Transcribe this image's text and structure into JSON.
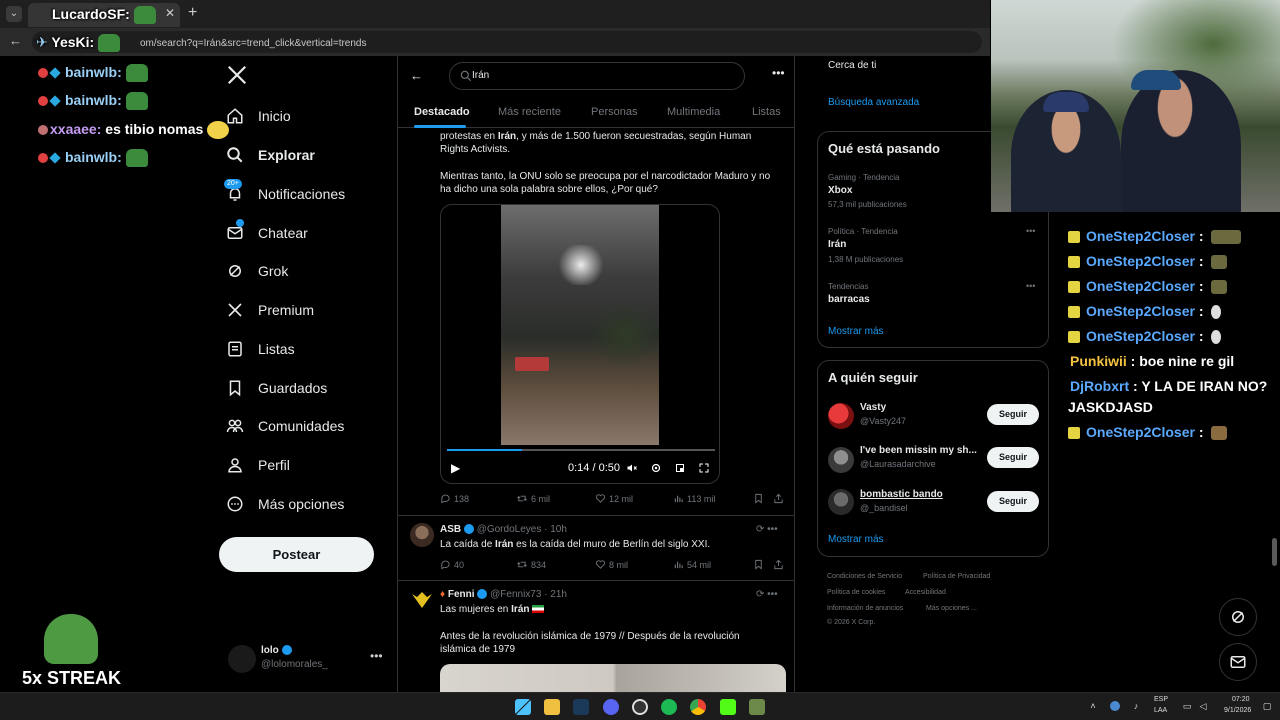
{
  "browser": {
    "tab_title": "LucardoSF:",
    "url": "om/search?q=Irán&src=trend_click&vertical=trends",
    "overlay_user": "YesKi:"
  },
  "overlay_chat": [
    {
      "user": "bainwlb:",
      "msg": ""
    },
    {
      "user": "bainwlb:",
      "msg": ""
    },
    {
      "user": "xxaaee:",
      "msg": "es tibio nomas"
    },
    {
      "user": "bainwlb:",
      "msg": ""
    }
  ],
  "nav": {
    "items": [
      {
        "label": "Inicio",
        "icon": "home-icon"
      },
      {
        "label": "Explorar",
        "icon": "search-icon"
      },
      {
        "label": "Notificaciones",
        "icon": "bell-icon",
        "badge": "20+"
      },
      {
        "label": "Chatear",
        "icon": "mail-icon"
      },
      {
        "label": "Grok",
        "icon": "grok-icon"
      },
      {
        "label": "Premium",
        "icon": "x-icon"
      },
      {
        "label": "Listas",
        "icon": "list-icon"
      },
      {
        "label": "Guardados",
        "icon": "bookmark-icon"
      },
      {
        "label": "Comunidades",
        "icon": "people-icon"
      },
      {
        "label": "Perfil",
        "icon": "user-icon"
      },
      {
        "label": "Más opciones",
        "icon": "more-icon"
      }
    ],
    "post_label": "Postear",
    "profile_name": "lolo",
    "profile_handle": "@lolomorales_"
  },
  "search": {
    "query": "Irán",
    "tabs": [
      "Destacado",
      "Más reciente",
      "Personas",
      "Multimedia",
      "Listas"
    ]
  },
  "tweet1": {
    "line1_pre": "protestas en ",
    "line1_bold": "Irán",
    "line1_post": ", y más de 1.500 fueron secuestradas, según Human",
    "line2": "Rights Activists.",
    "line3": "Mientras tanto, la ONU solo se preocupa por el narcodictador Maduro y no",
    "line4": "ha dicho una sola palabra sobre ellos, ¿Por qué?",
    "video_time": "0:14 / 0:50",
    "video_progress": 0.28,
    "replies": "138",
    "reposts": "6 mil",
    "likes": "12 mil",
    "views": "113 mil"
  },
  "tweet2": {
    "name": "ASB",
    "handle": "@GordoLeyes",
    "time": "· 10h",
    "text_pre": "La caída de ",
    "text_bold": "Irán",
    "text_post": " es la caída del muro de Berlín del siglo XXI.",
    "replies": "40",
    "reposts": "834",
    "likes": "8 mil",
    "views": "54 mil"
  },
  "tweet3": {
    "name": "Fenni",
    "handle": "@Fennix73",
    "time": "· 21h",
    "text1_pre": "Las mujeres en ",
    "text1_bold": "Irán",
    "text2": "Antes de la revolución islámica de 1979 // Después de la revolución",
    "text3": "islámica de 1979"
  },
  "right": {
    "search_filter": "Cerca de ti",
    "advanced": "Búsqueda avanzada",
    "trends_title": "Qué está pasando",
    "trends": [
      {
        "meta": "Gaming · Tendencia",
        "name": "Xbox",
        "count": "57,3 mil publicaciones"
      },
      {
        "meta": "Política · Tendencia",
        "name": "Irán",
        "count": "1,38 M publicaciones"
      },
      {
        "meta": "Tendencias",
        "name": "barracas",
        "count": ""
      }
    ],
    "show_more": "Mostrar más",
    "follow_title": "A quién seguir",
    "follow": [
      {
        "name": "Vasty",
        "handle": "@Vasty247",
        "button": "Seguir"
      },
      {
        "name": "I've been missin my sh...",
        "handle": "@Laurasadarchive",
        "button": "Seguir"
      },
      {
        "name": "bombastic bando",
        "handle": "@_bandisel",
        "button": "Seguir"
      }
    ],
    "show_more2": "Mostrar más",
    "footer": [
      "Condiciones de Servicio",
      "Política de Privacidad",
      "Política de cookies",
      "Accesibilidad",
      "Información de anuncios",
      "Más opciones ...",
      "© 2026 X Corp."
    ]
  },
  "stream_chat": [
    {
      "user": "OneStep2Closer",
      "msg": ""
    },
    {
      "user": "OneStep2Closer",
      "msg": ""
    },
    {
      "user": "OneStep2Closer",
      "msg": ""
    },
    {
      "user": "OneStep2Closer",
      "msg": ""
    },
    {
      "user": "OneStep2Closer",
      "msg": ""
    },
    {
      "user": "Punkiwii",
      "msg": "boe nine re gil"
    },
    {
      "user": "DjRobxrt",
      "msg": "Y LA DE IRAN NO?"
    },
    {
      "user": "",
      "msg": "JASKDJASD"
    },
    {
      "user": "OneStep2Closer",
      "msg": ""
    }
  ],
  "streak": "5x STREAK",
  "taskbar": {
    "lang1": "ESP",
    "lang2": "LAA",
    "time": "07:20",
    "date": "9/1/2026"
  }
}
